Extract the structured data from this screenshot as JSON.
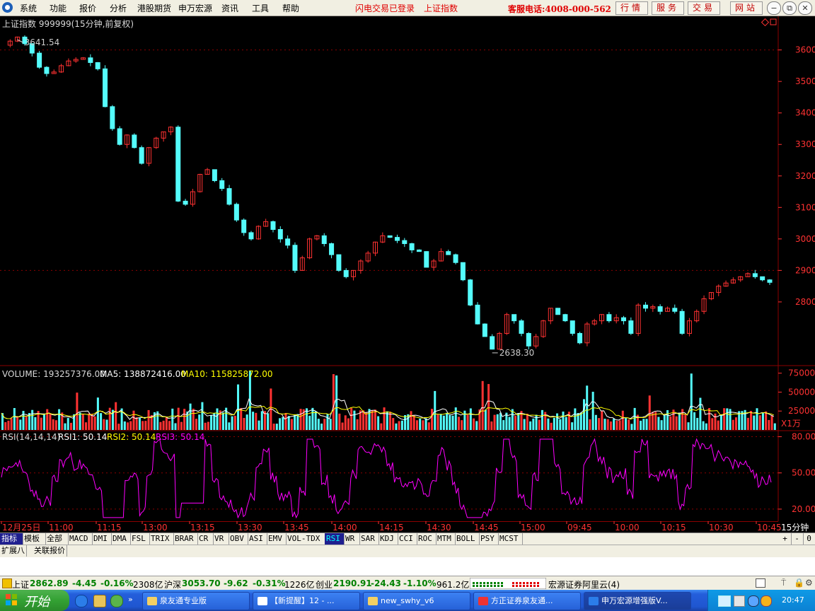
{
  "menu": {
    "items": [
      "系统",
      "功能",
      "报价",
      "分析",
      "港股期货",
      "申万宏源",
      "资讯",
      "工具",
      "帮助"
    ],
    "status_flash": "闪电交易已登录",
    "status_index": "上证指数",
    "hotline": "客服电话:4008-000-562",
    "service_buttons": [
      "行情",
      "服务",
      "交易",
      "网站"
    ],
    "window_buttons": [
      "−",
      "⧉",
      "✕"
    ]
  },
  "price_panel": {
    "title": "上证指数 999999(15分钟,前复权)",
    "high_label": "3641.54",
    "low_label": "2638.30",
    "y_ticks": [
      "3600",
      "3500",
      "3400",
      "3300",
      "3200",
      "3100",
      "3000",
      "2900",
      "2800"
    ]
  },
  "volume_panel": {
    "label": "VOLUME: 193257376.00",
    "ma5": "MA5: 138872416.00",
    "ma10": "MA10: 115825872.00",
    "y_ticks": [
      "75000",
      "50000",
      "25000"
    ],
    "unit": "X1万"
  },
  "rsi_panel": {
    "label": "RSI(14,14,14)",
    "rsi1": "RSI1: 50.14",
    "rsi2": "RSI2: 50.14",
    "rsi3": "RSI3: 50.14",
    "y_ticks": [
      "80.00",
      "50.00",
      "20.00"
    ]
  },
  "time_axis": {
    "labels": [
      "12月25日",
      "11:00",
      "11:15",
      "13:00",
      "13:15",
      "13:30",
      "13:45",
      "14:00",
      "14:15",
      "14:30",
      "14:45",
      "15:00",
      "09:45",
      "10:00",
      "10:15",
      "10:30",
      "10:45"
    ],
    "period": "15分钟"
  },
  "indicator_tabs": [
    "指标",
    "模板",
    "全部",
    "MACD",
    "DMI",
    "DMA",
    "FSL",
    "TRIX",
    "BRAR",
    "CR",
    "VR",
    "OBV",
    "ASI",
    "EMV",
    "VOL-TDX",
    "RSI",
    "WR",
    "SAR",
    "KDJ",
    "CCI",
    "ROC",
    "MTM",
    "BOLL",
    "PSY",
    "MCST"
  ],
  "active_tab": "RSI",
  "tab_controls": [
    "+",
    "-",
    "0"
  ],
  "sub_tabs": [
    "扩展八",
    "关联报价"
  ],
  "quotes": {
    "sh_name": "上证",
    "sh_val": "2862.89",
    "sh_chg": "-4.45",
    "sh_pct": "-0.16%",
    "sh_amt": "2308亿",
    "hs_name": "沪深",
    "hs_val": "3053.70",
    "hs_chg": "-9.62",
    "hs_pct": "-0.31%",
    "hs_amt": "1226亿",
    "cy_name": "创业",
    "cy_val": "2190.91",
    "cy_chg": "-24.43",
    "cy_pct": "-1.10%",
    "cy_amt": "961.2亿",
    "server": "宏源证券阿里云(4)"
  },
  "taskbar": {
    "start": "开始",
    "tasks": [
      "泉友通专业版",
      "【新提醒】12 - ...",
      "new_swhy_v6",
      "方正证券泉友通...",
      "申万宏源增强版V..."
    ],
    "clock": "20:47"
  },
  "colors": {
    "up": "#ff3232",
    "down": "#54fcfc",
    "ma5": "#ffffff",
    "ma10": "#ffff00",
    "rsi": "#ff00ff",
    "grid": "#8b0000"
  },
  "chart_data": {
    "type": "candlestick",
    "title": "上证指数 999999(15分钟,前复权)",
    "x_period": "15分钟",
    "ylim_price": [
      2600,
      3680
    ],
    "price_series": [
      3615,
      3628,
      3641,
      3620,
      3590,
      3545,
      3525,
      3530,
      3550,
      3565,
      3570,
      3575,
      3560,
      3540,
      3420,
      3350,
      3300,
      3330,
      3290,
      3240,
      3290,
      3320,
      3340,
      3355,
      3120,
      3110,
      3150,
      3205,
      3220,
      3185,
      3160,
      3110,
      3060,
      3020,
      3000,
      3040,
      3055,
      3030,
      3000,
      2980,
      2900,
      2940,
      3000,
      3010,
      2985,
      2950,
      2900,
      2880,
      2900,
      2930,
      2955,
      2990,
      3010,
      3005,
      2995,
      2985,
      2965,
      2960,
      2910,
      2930,
      2960,
      2950,
      2925,
      2870,
      2790,
      2730,
      2690,
      2650,
      2700,
      2760,
      2740,
      2700,
      2660,
      2690,
      2740,
      2780,
      2760,
      2740,
      2700,
      2670,
      2730,
      2740,
      2760,
      2740,
      2750,
      2740,
      2700,
      2790,
      2780,
      2785,
      2770,
      2780,
      2770,
      2700,
      2740,
      2770,
      2810,
      2830,
      2850,
      2860,
      2870,
      2880,
      2890,
      2880,
      2870,
      2862
    ],
    "high": 3641.54,
    "low": 2638.3,
    "volume_ylim": [
      0,
      85000
    ],
    "rsi_ylim": [
      10,
      85
    ],
    "rsi_levels": [
      20,
      50,
      80
    ]
  }
}
